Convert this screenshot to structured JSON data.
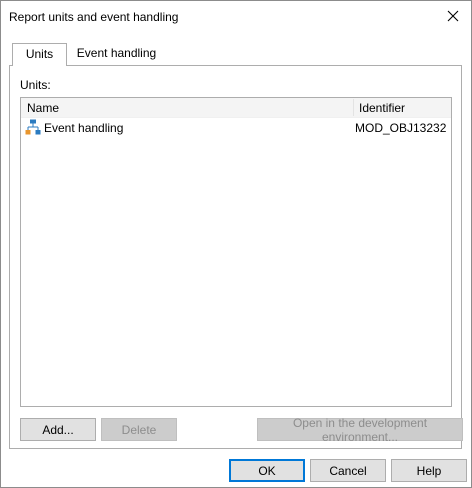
{
  "window": {
    "title": "Report units and event handling"
  },
  "tabs": [
    {
      "label": "Units",
      "active": true
    },
    {
      "label": "Event handling",
      "active": false
    }
  ],
  "units_panel": {
    "label": "Units:",
    "columns": {
      "name": "Name",
      "identifier": "Identifier"
    },
    "rows": [
      {
        "name": "Event handling",
        "identifier": "MOD_OBJ13232",
        "icon": "module-tree-icon"
      }
    ],
    "buttons": {
      "add": "Add...",
      "delete": "Delete",
      "open_dev_env": "Open in the development environment..."
    }
  },
  "footer": {
    "ok": "OK",
    "cancel": "Cancel",
    "help": "Help"
  },
  "colors": {
    "accent": "#0078d7",
    "icon_orange": "#e8962e",
    "icon_blue": "#2b7bc0"
  }
}
